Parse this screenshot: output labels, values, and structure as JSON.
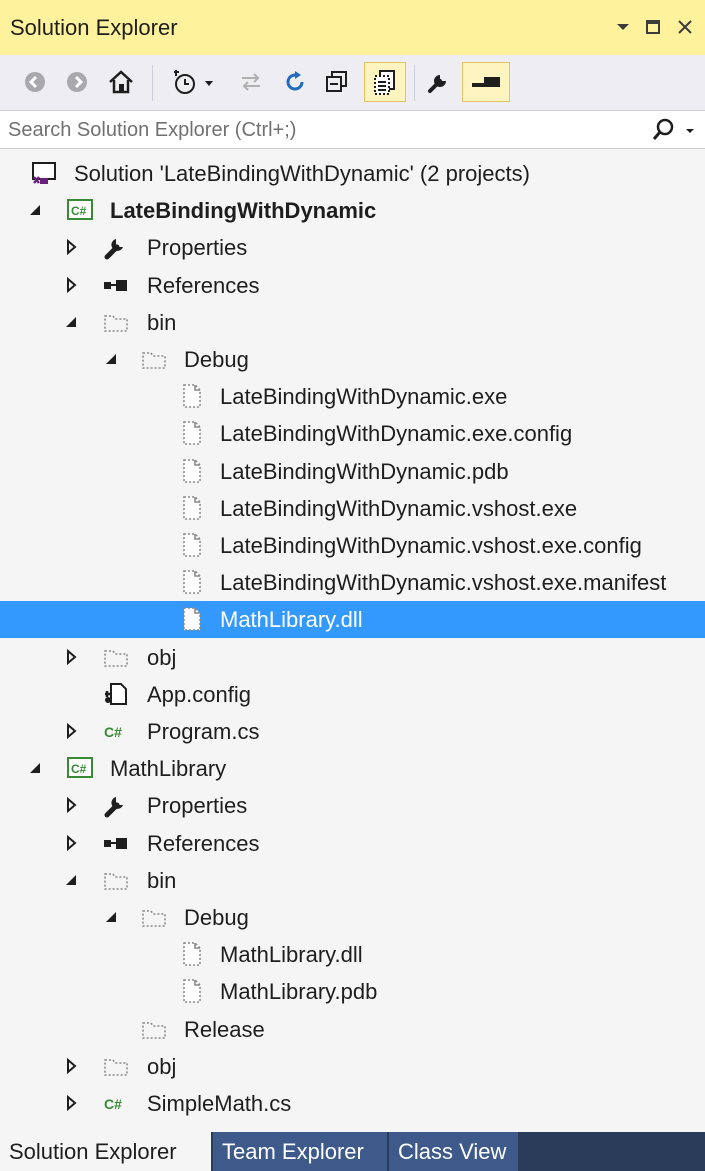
{
  "window": {
    "title": "Solution Explorer",
    "controls": [
      "dropdown-arrow-icon",
      "maximize-icon",
      "close-icon"
    ]
  },
  "toolbar": {
    "buttons": [
      "back-icon",
      "forward-icon",
      "home-icon",
      "pending-changes-filter-icon",
      "sync-with-active-document-icon",
      "refresh-icon",
      "collapse-all-icon",
      "show-all-files-icon",
      "properties-icon",
      "preview-selected-items-icon"
    ]
  },
  "search": {
    "placeholder": "Search Solution Explorer (Ctrl+;)"
  },
  "tree": {
    "items": [
      {
        "label": "Solution 'LateBindingWithDynamic' (2 projects)",
        "icon": "solution-icon",
        "expander": "none",
        "bold": false,
        "selected": false
      },
      {
        "label": "LateBindingWithDynamic",
        "icon": "csharp-project-icon",
        "expander": "expanded",
        "bold": true,
        "selected": false
      },
      {
        "label": "Properties",
        "icon": "wrench-icon",
        "expander": "collapsed",
        "bold": false,
        "selected": false
      },
      {
        "label": "References",
        "icon": "references-icon",
        "expander": "collapsed",
        "bold": false,
        "selected": false
      },
      {
        "label": "bin",
        "icon": "folder-excluded-icon",
        "expander": "expanded",
        "bold": false,
        "selected": false
      },
      {
        "label": "Debug",
        "icon": "folder-excluded-icon",
        "expander": "expanded",
        "bold": false,
        "selected": false
      },
      {
        "label": "LateBindingWithDynamic.exe",
        "icon": "file-excluded-icon",
        "expander": "none",
        "bold": false,
        "selected": false
      },
      {
        "label": "LateBindingWithDynamic.exe.config",
        "icon": "file-excluded-icon",
        "expander": "none",
        "bold": false,
        "selected": false
      },
      {
        "label": "LateBindingWithDynamic.pdb",
        "icon": "file-excluded-icon",
        "expander": "none",
        "bold": false,
        "selected": false
      },
      {
        "label": "LateBindingWithDynamic.vshost.exe",
        "icon": "file-excluded-icon",
        "expander": "none",
        "bold": false,
        "selected": false
      },
      {
        "label": "LateBindingWithDynamic.vshost.exe.config",
        "icon": "file-excluded-icon",
        "expander": "none",
        "bold": false,
        "selected": false
      },
      {
        "label": "LateBindingWithDynamic.vshost.exe.manifest",
        "icon": "file-excluded-icon",
        "expander": "none",
        "bold": false,
        "selected": false
      },
      {
        "label": "MathLibrary.dll",
        "icon": "file-excluded-icon",
        "expander": "none",
        "bold": false,
        "selected": true
      },
      {
        "label": "obj",
        "icon": "folder-excluded-icon",
        "expander": "collapsed",
        "bold": false,
        "selected": false
      },
      {
        "label": "App.config",
        "icon": "config-file-icon",
        "expander": "none",
        "bold": false,
        "selected": false
      },
      {
        "label": "Program.cs",
        "icon": "csharp-file-icon",
        "expander": "collapsed",
        "bold": false,
        "selected": false
      },
      {
        "label": "MathLibrary",
        "icon": "csharp-project-icon",
        "expander": "expanded",
        "bold": false,
        "selected": false
      },
      {
        "label": "Properties",
        "icon": "wrench-icon",
        "expander": "collapsed",
        "bold": false,
        "selected": false
      },
      {
        "label": "References",
        "icon": "references-icon",
        "expander": "collapsed",
        "bold": false,
        "selected": false
      },
      {
        "label": "bin",
        "icon": "folder-excluded-icon",
        "expander": "expanded",
        "bold": false,
        "selected": false
      },
      {
        "label": "Debug",
        "icon": "folder-excluded-icon",
        "expander": "expanded",
        "bold": false,
        "selected": false
      },
      {
        "label": "MathLibrary.dll",
        "icon": "file-excluded-icon",
        "expander": "none",
        "bold": false,
        "selected": false
      },
      {
        "label": "MathLibrary.pdb",
        "icon": "file-excluded-icon",
        "expander": "none",
        "bold": false,
        "selected": false
      },
      {
        "label": "Release",
        "icon": "folder-excluded-icon",
        "expander": "none",
        "bold": false,
        "selected": false
      },
      {
        "label": "obj",
        "icon": "folder-excluded-icon",
        "expander": "collapsed",
        "bold": false,
        "selected": false
      },
      {
        "label": "SimpleMath.cs",
        "icon": "csharp-file-icon",
        "expander": "collapsed",
        "bold": false,
        "selected": false
      }
    ]
  },
  "tabs": [
    {
      "label": "Solution Explorer",
      "active": true
    },
    {
      "label": "Team Explorer",
      "active": false
    },
    {
      "label": "Class View",
      "active": false
    }
  ],
  "colors": {
    "title_bar": "#fff29d",
    "selection": "#3399ff",
    "tab_strip": "#2b3b5a",
    "csharp_green": "#388a34"
  }
}
